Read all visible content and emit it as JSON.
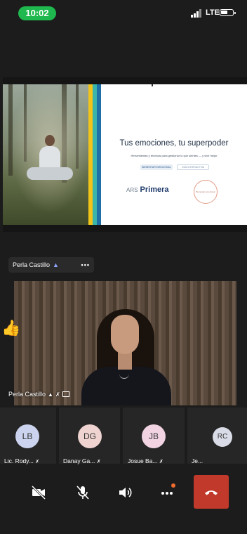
{
  "status_bar": {
    "time": "10:02",
    "network": "LTE"
  },
  "slide": {
    "title": "Tus emociones, tu superpoder",
    "subtitle": "Herramientas y técnicas para gestionar lo que sientes — y vivir mejor",
    "tag_primary": "BIENESTAR EMOCIONAL",
    "tag_secondary": "GUÍA INTERACTIVA",
    "brand_prefix": "ARS",
    "brand_name": "Primera",
    "seal_text": "Bienestar emocional"
  },
  "presenter_tag": {
    "name": "Perla Castillo",
    "more": "•••"
  },
  "video": {
    "name": "Perla Castillo"
  },
  "reaction_emoji": "👍",
  "participants": [
    {
      "initials": "LB",
      "label": "Lic. Rody...",
      "avatar_color": "#cbd3ee"
    },
    {
      "initials": "DG",
      "label": "Danay Ga...",
      "avatar_color": "#eed3d0"
    },
    {
      "initials": "JB",
      "label": "Josue Ba...",
      "avatar_color": "#f1d3e2"
    },
    {
      "initials": "RC",
      "label": "Je...",
      "avatar_color": "#d9dbe6"
    }
  ],
  "controls": {
    "camera_icon": "camera-off-icon",
    "mic_icon": "mic-off-icon",
    "speaker_icon": "speaker-icon",
    "more_icon": "more-icon",
    "hangup_icon": "hangup-icon",
    "hangup_color": "#c0392b",
    "notification_color": "#ef6c2f"
  }
}
